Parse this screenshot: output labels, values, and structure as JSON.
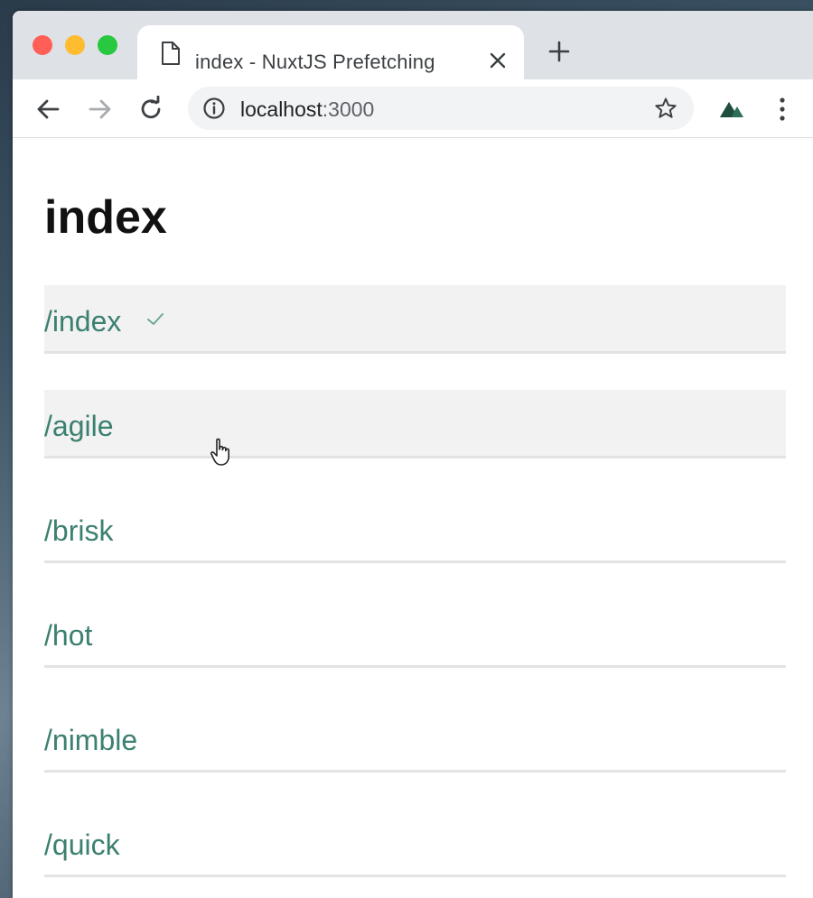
{
  "browser": {
    "tab": {
      "title": "index - NuxtJS Prefetching",
      "page_icon": "page-icon",
      "close_icon": "close-icon"
    },
    "new_tab_icon": "plus-icon",
    "toolbar": {
      "back_icon": "arrow-left-icon",
      "forward_icon": "arrow-right-icon",
      "reload_icon": "reload-icon",
      "info_icon": "info-icon",
      "url_host": "localhost",
      "url_port": ":3000",
      "bookmark_icon": "star-icon",
      "extension_icon": "nuxt-mountain-icon",
      "menu_icon": "kebab-menu-icon"
    }
  },
  "page": {
    "title": "index",
    "links": [
      {
        "label": "/index",
        "prefetched": true,
        "visited_check": true
      },
      {
        "label": "/agile",
        "prefetched": true,
        "visited_check": false
      },
      {
        "label": "/brisk",
        "prefetched": false,
        "visited_check": false
      },
      {
        "label": "/hot",
        "prefetched": false,
        "visited_check": false
      },
      {
        "label": "/nimble",
        "prefetched": false,
        "visited_check": false
      },
      {
        "label": "/quick",
        "prefetched": false,
        "visited_check": false
      }
    ],
    "check_icon": "check-icon",
    "cursor_icon": "hand-pointer-icon"
  },
  "colors": {
    "link": "#3b8070",
    "prefetched_bg": "#f2f2f2",
    "divider": "#e3e3e3",
    "tabstrip": "#dee1e6",
    "omnibox": "#f1f3f4"
  }
}
